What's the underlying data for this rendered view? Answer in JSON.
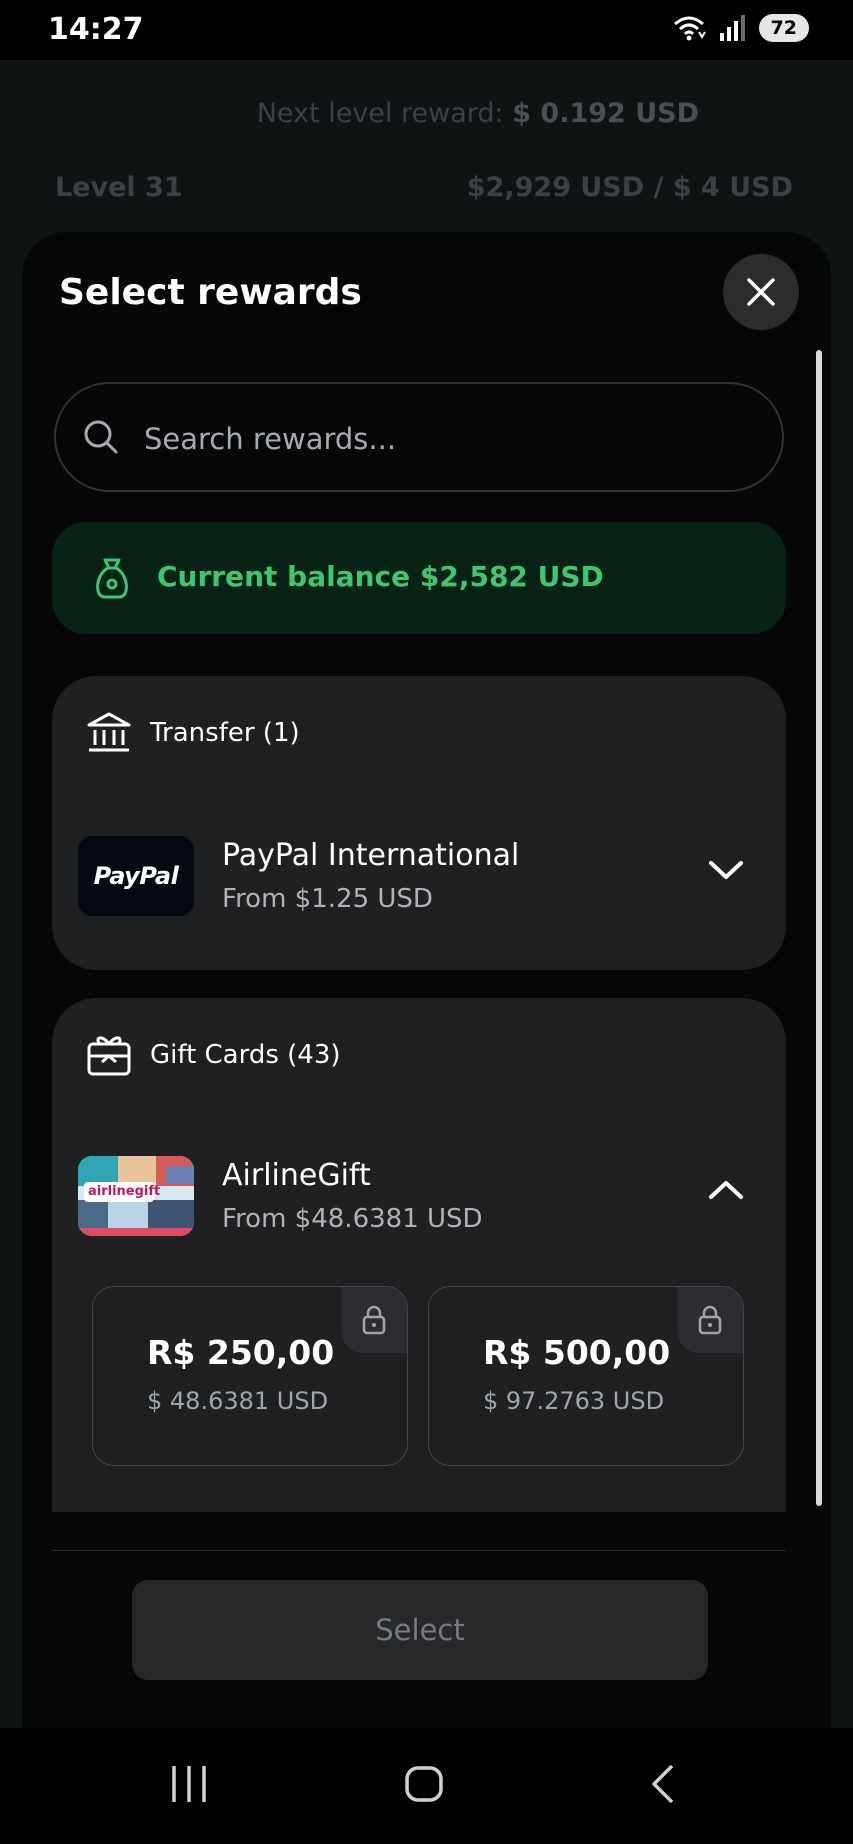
{
  "status_bar": {
    "time": "14:27",
    "battery": "72"
  },
  "background": {
    "next_level_label": "Next level reward:",
    "next_level_value": "$ 0.192 USD",
    "level": "Level 31",
    "progress": "$2,929 USD / $ 4 USD"
  },
  "sheet": {
    "title": "Select rewards",
    "search_placeholder": "Search rewards...",
    "balance": "Current balance $2,582 USD",
    "transfer": {
      "label": "Transfer (1)",
      "item_logo_text": "PayPal",
      "item_title": "PayPal International",
      "item_sub": "From $1.25 USD"
    },
    "gift_cards": {
      "label": "Gift Cards (43)",
      "item_logo_text": "airlinegift",
      "item_title": "AirlineGift",
      "item_sub": "From $48.6381 USD",
      "denominations": [
        {
          "value": "R$ 250,00",
          "usd": "$ 48.6381 USD"
        },
        {
          "value": "R$ 500,00",
          "usd": "$ 97.2763 USD"
        }
      ]
    },
    "select_label": "Select"
  },
  "colors": {
    "accent_green": "#3ec671",
    "balance_bg": "#082316",
    "card_bg": "#1f2022"
  }
}
